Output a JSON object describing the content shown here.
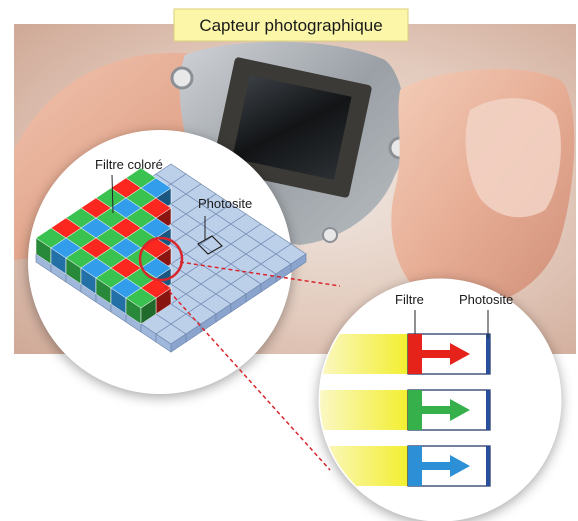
{
  "title": "Capteur photographique",
  "labels": {
    "filtre_colore": "Filtre coloré",
    "photosite_left": "Photosite",
    "filtre": "Filtre",
    "photosite_right": "Photosite"
  },
  "colors": {
    "title_bg": "#fbf6a8",
    "filter_red": "#e5231b",
    "filter_green": "#35b04a",
    "filter_blue": "#2d8fd6",
    "photosite_fill": "#bcd0ea",
    "light_yellow": "#f2ef3a",
    "connector": "#d8262c"
  },
  "channels": [
    {
      "name": "red",
      "color": "#e5231b"
    },
    {
      "name": "green",
      "color": "#35b04a"
    },
    {
      "name": "blue",
      "color": "#2d8fd6"
    }
  ]
}
